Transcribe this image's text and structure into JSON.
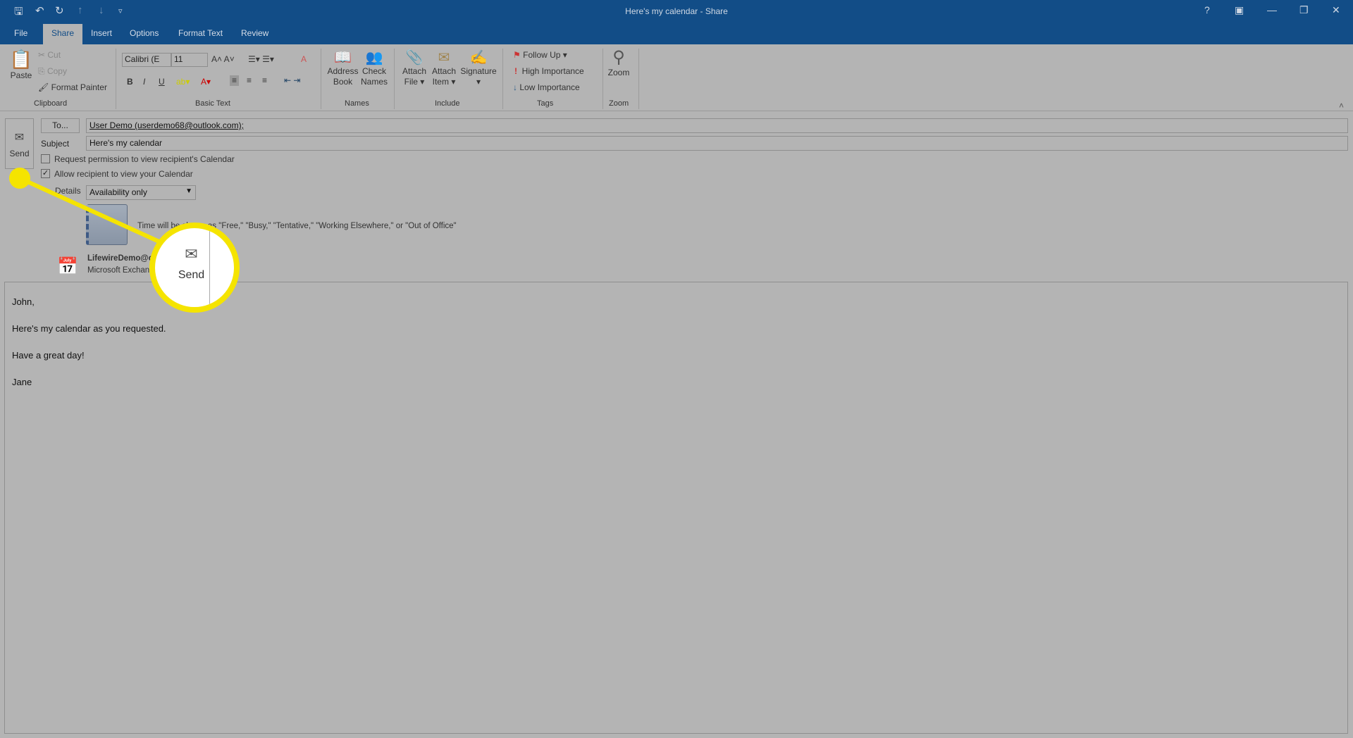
{
  "window": {
    "title": "Here's my calendar  -  Share",
    "help": "?"
  },
  "tabs": [
    {
      "label": "File"
    },
    {
      "label": "Share",
      "active": true
    },
    {
      "label": "Insert"
    },
    {
      "label": "Options"
    },
    {
      "label": "Format Text"
    },
    {
      "label": "Review"
    }
  ],
  "ribbon": {
    "clipboard": {
      "paste": "Paste",
      "cut": "Cut",
      "copy": "Copy",
      "format_painter": "Format Painter",
      "group": "Clipboard"
    },
    "basic_text": {
      "font": "Calibri (E",
      "size": "11",
      "bold": "B",
      "italic": "I",
      "underline": "U",
      "group": "Basic Text"
    },
    "names": {
      "address_book": [
        "Address",
        "Book"
      ],
      "check_names": [
        "Check",
        "Names"
      ],
      "group": "Names"
    },
    "include": {
      "attach_file": [
        "Attach",
        "File ▾"
      ],
      "attach_item": [
        "Attach",
        "Item ▾"
      ],
      "signature": [
        "Signature",
        "▾"
      ],
      "group": "Include"
    },
    "tags": {
      "follow_up": "Follow Up ▾",
      "high": "High Importance",
      "low": "Low Importance",
      "group": "Tags"
    },
    "zoom": {
      "label": "Zoom",
      "group": "Zoom"
    }
  },
  "compose": {
    "send": "Send",
    "to_button": "To...",
    "to_value": "User Demo (userdemo68@outlook.com);",
    "subject_label": "Subject",
    "subject_value": "Here's my calendar",
    "request_permission": {
      "label": "Request permission to view recipient's Calendar",
      "checked": false
    },
    "allow_view": {
      "label": "Allow recipient to view your Calendar",
      "checked": true
    },
    "details_label": "Details",
    "details_value": "Availability only",
    "details_desc": "Time will be shown as \"Free,\" \"Busy,\" \"Tentative,\" \"Working Elsewhere,\" or \"Out of Office\"",
    "calendar_name": "LifewireDemo@o",
    "calendar_source": "Microsoft Exchan"
  },
  "body": [
    "John,",
    "Here's my calendar as you requested.",
    "Have a great day!",
    "Jane"
  ],
  "callout": {
    "label": "Send",
    "color": "#f5e400"
  }
}
